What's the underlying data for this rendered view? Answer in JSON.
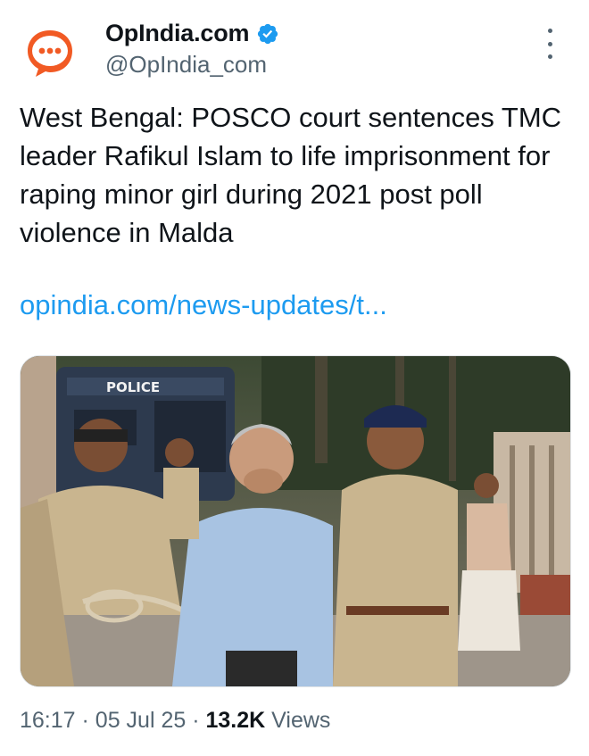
{
  "account": {
    "display_name": "OpIndia.com",
    "handle": "@OpIndia_com",
    "verified": true,
    "avatar_icon": "speech-bubble-logo",
    "brand_color": "#f15a24"
  },
  "tweet": {
    "text": "West Bengal: POSCO court sentences TMC leader Rafikul Islam to life imprisonment for raping minor girl during 2021 post poll violence in Malda",
    "link": "opindia.com/news-updates/t...",
    "link_color": "#1d9bf0",
    "image": {
      "vehicle_text": "POLICE"
    }
  },
  "meta": {
    "time": "16:17",
    "separator": "·",
    "date": "05 Jul 25",
    "views_count": "13.2K",
    "views_label": "Views"
  },
  "icons": {
    "verified": "verified-badge-icon",
    "more": "more-options-icon"
  }
}
